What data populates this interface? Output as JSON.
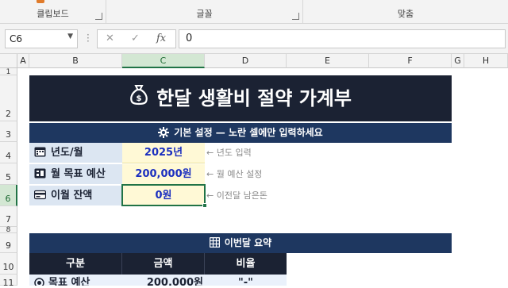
{
  "ribbon": {
    "groups": [
      {
        "label": "클립보드"
      },
      {
        "label": "글꼴"
      },
      {
        "label": "맞춤"
      }
    ]
  },
  "formula_bar": {
    "name_box": "C6",
    "formula": "0",
    "fx_label": "fx",
    "cancel_glyph": "✕",
    "enter_glyph": "✓"
  },
  "columns": [
    "A",
    "B",
    "C",
    "D",
    "E",
    "F",
    "G",
    "H"
  ],
  "rows": [
    "1",
    "2",
    "3",
    "4",
    "5",
    "6",
    "7",
    "8",
    "9",
    "10",
    "11"
  ],
  "selected_cell": {
    "column": "C",
    "row": "6"
  },
  "sheet": {
    "title": "한달 생활비 절약 가계부",
    "title_icon": "money-bag-icon",
    "settings_header": "기본 설정 — 노란 셀에만 입력하세요",
    "settings_icon": "gear-icon",
    "settings": [
      {
        "label": "년도/월",
        "value": "2025년",
        "hint": "← 년도 입력",
        "icon": "calendar-icon"
      },
      {
        "label": "월 목표 예산",
        "value": "200,000원",
        "hint": "← 월 예산 설정",
        "icon": "budget-icon"
      },
      {
        "label": "이월 잔액",
        "value": "0원",
        "hint": "← 이전달 남은돈",
        "icon": "card-icon"
      }
    ],
    "summary_header": "이번달 요약",
    "summary_icon": "calculator-icon",
    "summary_columns": [
      "구분",
      "금액",
      "비율"
    ],
    "summary_rows": [
      {
        "label": "목표 예산",
        "amount": "200,000원",
        "ratio": "\"-\"",
        "icon": "target-icon"
      }
    ]
  },
  "colors": {
    "title_bg": "#1b2233",
    "section_bg": "#1e3760",
    "label_bg": "#dce6f2",
    "input_bg": "#fff9d6",
    "input_text": "#1b2fbf",
    "selection": "#217346"
  }
}
